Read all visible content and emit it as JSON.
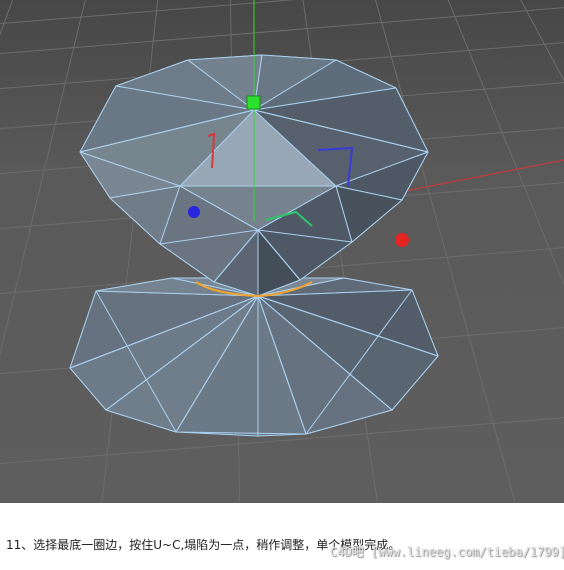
{
  "viewport": {
    "background_color": "#5b5b5b",
    "grid_color": "#6a6a6a",
    "mesh_face_color": "#6f7d8c",
    "mesh_edge_color": "#a9d0ee",
    "selected_edge_color": "#f4a42b",
    "axis_y_color": "#34d434",
    "axis_x_color": "#e23b3b",
    "axis_z_color": "#3b3be2"
  },
  "caption": {
    "text": "11、选择最底一圈边，按住U~C,塌陷为一点，稍作调整，单个模型完成。"
  },
  "watermark": {
    "text": "C4D吧 [www.lineeg.com/tieba/1799]"
  }
}
